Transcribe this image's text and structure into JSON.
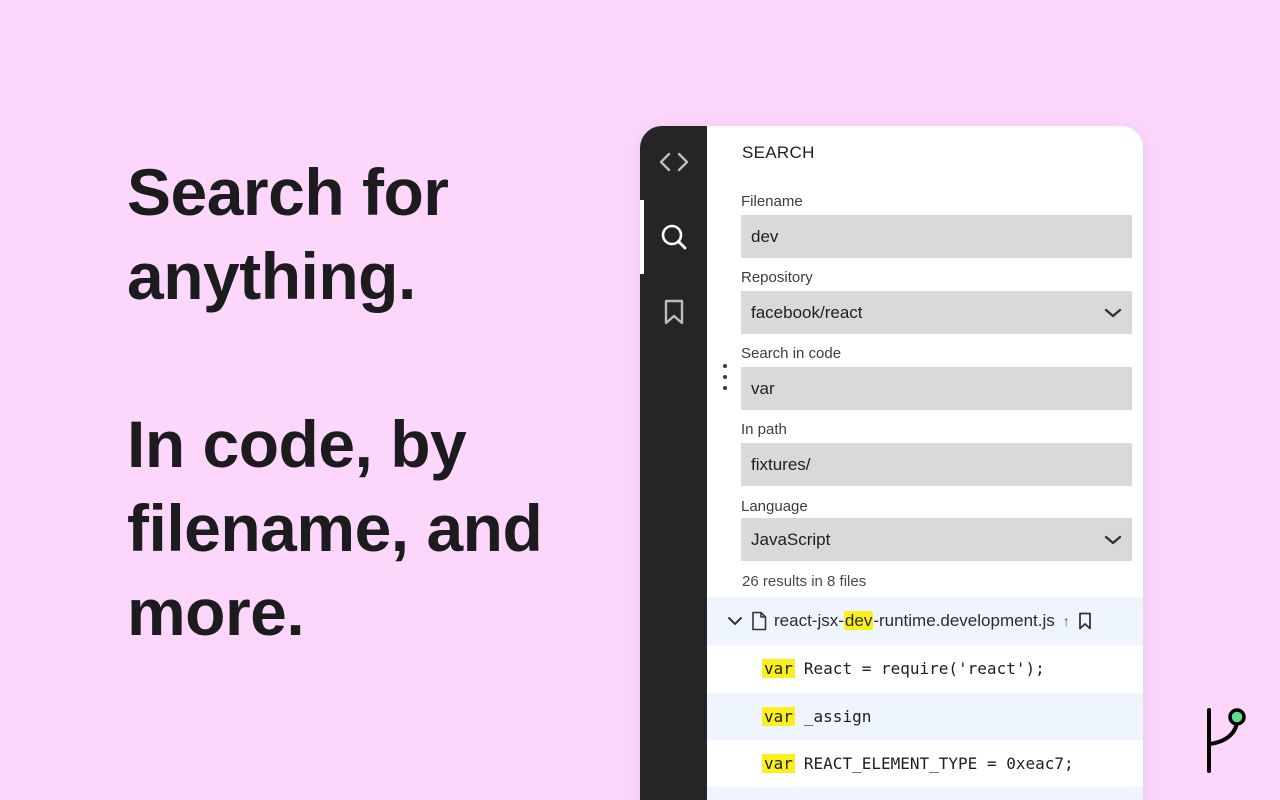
{
  "hero": {
    "line1": "Search for",
    "line2": "anything.",
    "line3": "In code, by",
    "line4": "filename, and",
    "line5": "more."
  },
  "activity_bar": {
    "icons": [
      "code-icon",
      "search-icon",
      "bookmark-icon"
    ],
    "active": "search"
  },
  "search_panel": {
    "title": "SEARCH",
    "filename": {
      "label": "Filename",
      "value": "dev"
    },
    "repository": {
      "label": "Repository",
      "value": "facebook/react"
    },
    "search_in_code": {
      "label": "Search in code",
      "value": "var"
    },
    "in_path": {
      "label": "In path",
      "value": "fixtures/"
    },
    "language": {
      "label": "Language",
      "value": "JavaScript"
    },
    "results_summary": "26 results in 8 files"
  },
  "results": {
    "file": {
      "name_prefix": "react-jsx-",
      "name_match": "dev",
      "name_suffix": "-runtime.development.js",
      "sort_indicator": "↑"
    },
    "lines": [
      {
        "keyword": "var",
        "rest": "React = require('react');"
      },
      {
        "keyword": "var",
        "rest": "_assign"
      },
      {
        "keyword": "var",
        "rest": "REACT_ELEMENT_TYPE = 0xeac7;"
      }
    ]
  },
  "colors": {
    "background": "#fcd7fb",
    "activity_bar": "#232527",
    "field_bg": "#d9d9d9",
    "highlight": "#fcef1e",
    "row_highlight": "#eef5ff",
    "logo_dot": "#5ee08a"
  }
}
